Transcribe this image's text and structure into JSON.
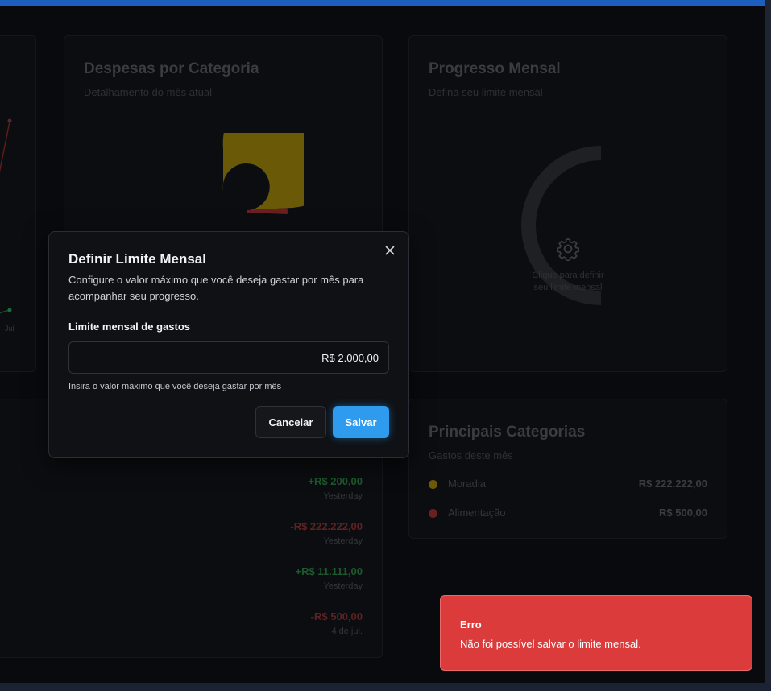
{
  "colors": {
    "accent": "#2f9bef",
    "error": "#dc3b3c",
    "positive": "#1c5a2d",
    "negative": "#5e2222",
    "category_moradia": "#6a5a08",
    "category_alimentacao": "#6a2020"
  },
  "line_chart": {
    "x_label_last": "Jul"
  },
  "expenses_card": {
    "title": "Despesas por Categoria",
    "subtitle": "Detalhamento do mês atual"
  },
  "progress_card": {
    "title": "Progresso Mensal",
    "subtitle": "Defina seu limite mensal",
    "hint": "Clique para definir seu limite mensal",
    "icon": "gear-icon"
  },
  "transactions": [
    {
      "amount": "+R$ 200,00",
      "date": "Yesterday",
      "type": "positive"
    },
    {
      "amount": "-R$ 222.222,00",
      "date": "Yesterday",
      "type": "negative"
    },
    {
      "amount": "+R$ 11.111,00",
      "date": "Yesterday",
      "type": "positive"
    },
    {
      "amount": "-R$ 500,00",
      "date": "4 de jul.",
      "type": "negative"
    }
  ],
  "top_categories": {
    "title": "Principais Categorias",
    "subtitle": "Gastos deste mês",
    "items": [
      {
        "name": "Moradia",
        "value": "R$ 222.222,00"
      },
      {
        "name": "Alimentação",
        "value": "R$ 500,00"
      }
    ]
  },
  "modal": {
    "title": "Definir Limite Mensal",
    "description": "Configure o valor máximo que você deseja gastar por mês para acompanhar seu progresso.",
    "field_label": "Limite mensal de gastos",
    "field_value": "R$ 2.000,00",
    "field_help": "Insira o valor máximo que você deseja gastar por mês",
    "cancel_label": "Cancelar",
    "save_label": "Salvar"
  },
  "toast": {
    "title": "Erro",
    "message": "Não foi possível salvar o limite mensal."
  }
}
